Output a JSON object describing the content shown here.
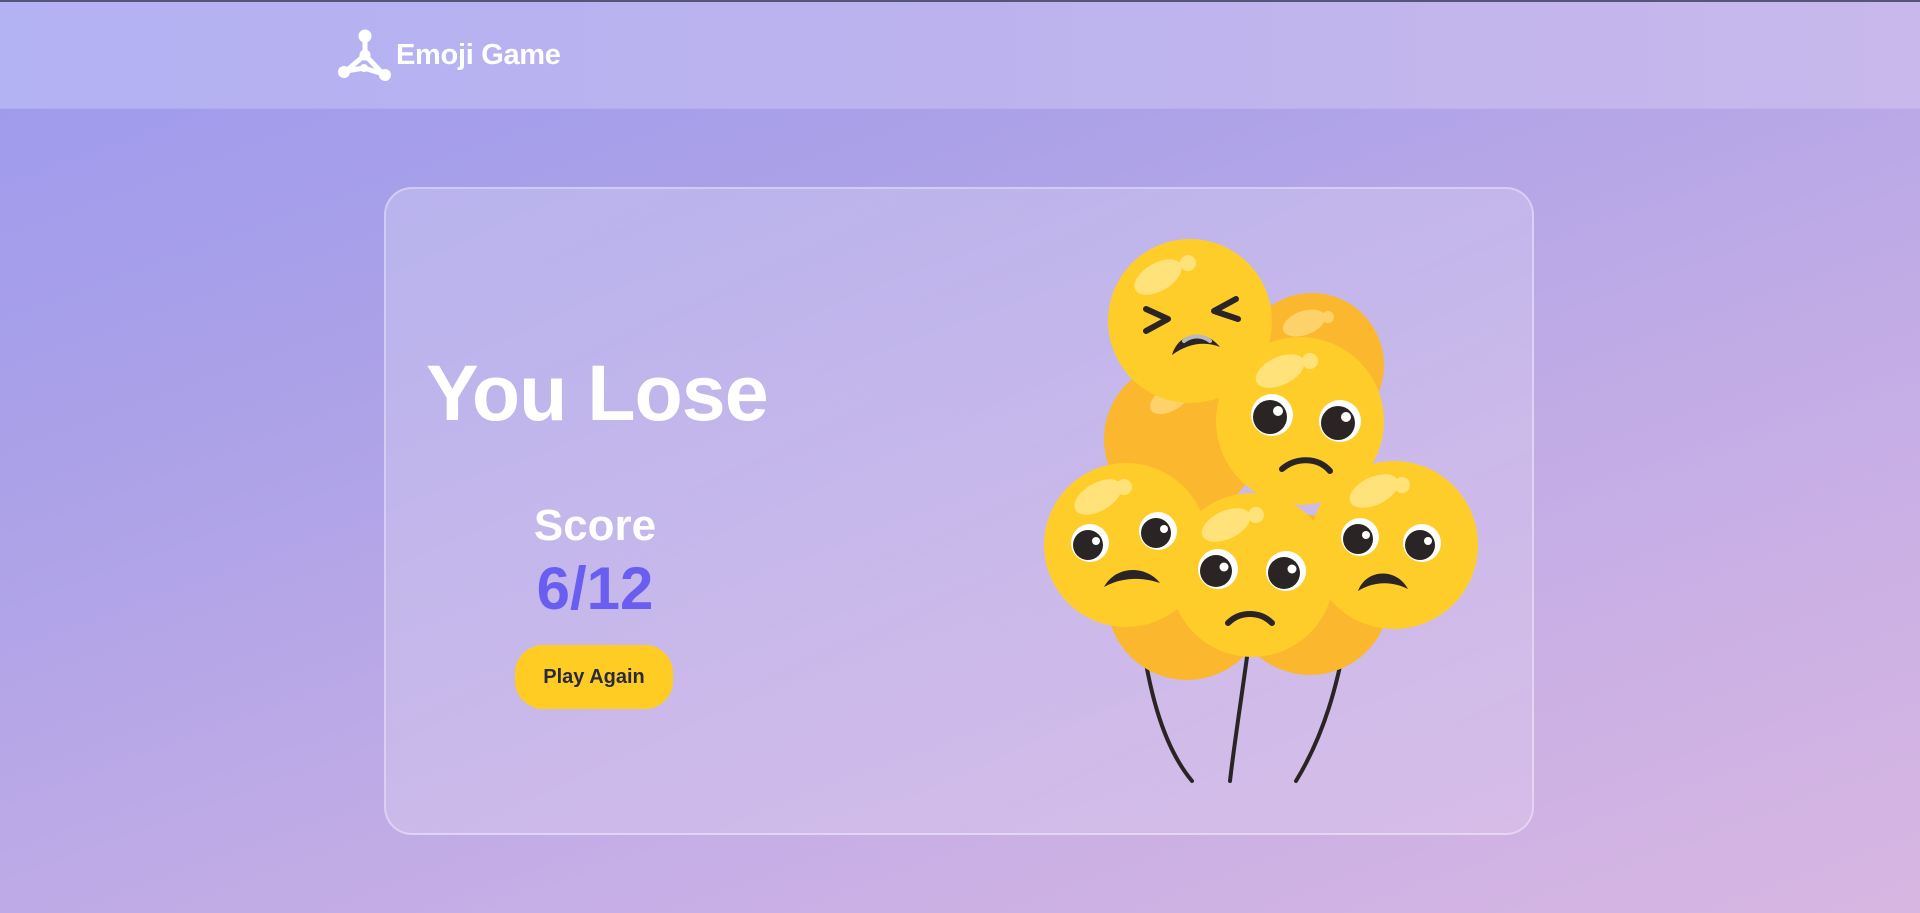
{
  "app": {
    "name": "Emoji Game",
    "logo_icon": "molecule-network-icon"
  },
  "result": {
    "title": "You Lose",
    "score_label": "Score",
    "score": 6,
    "total": 12,
    "score_text": "6/12",
    "play_again_label": "Play Again"
  },
  "illustration": {
    "icon": "sad-emoji-balloons-icon",
    "balloon_count": 8
  },
  "colors": {
    "accent": "#6a5ef0",
    "button": "#ffcc24",
    "emoji_yellow": "#ffcd2a",
    "emoji_back": "#fbb72e"
  }
}
